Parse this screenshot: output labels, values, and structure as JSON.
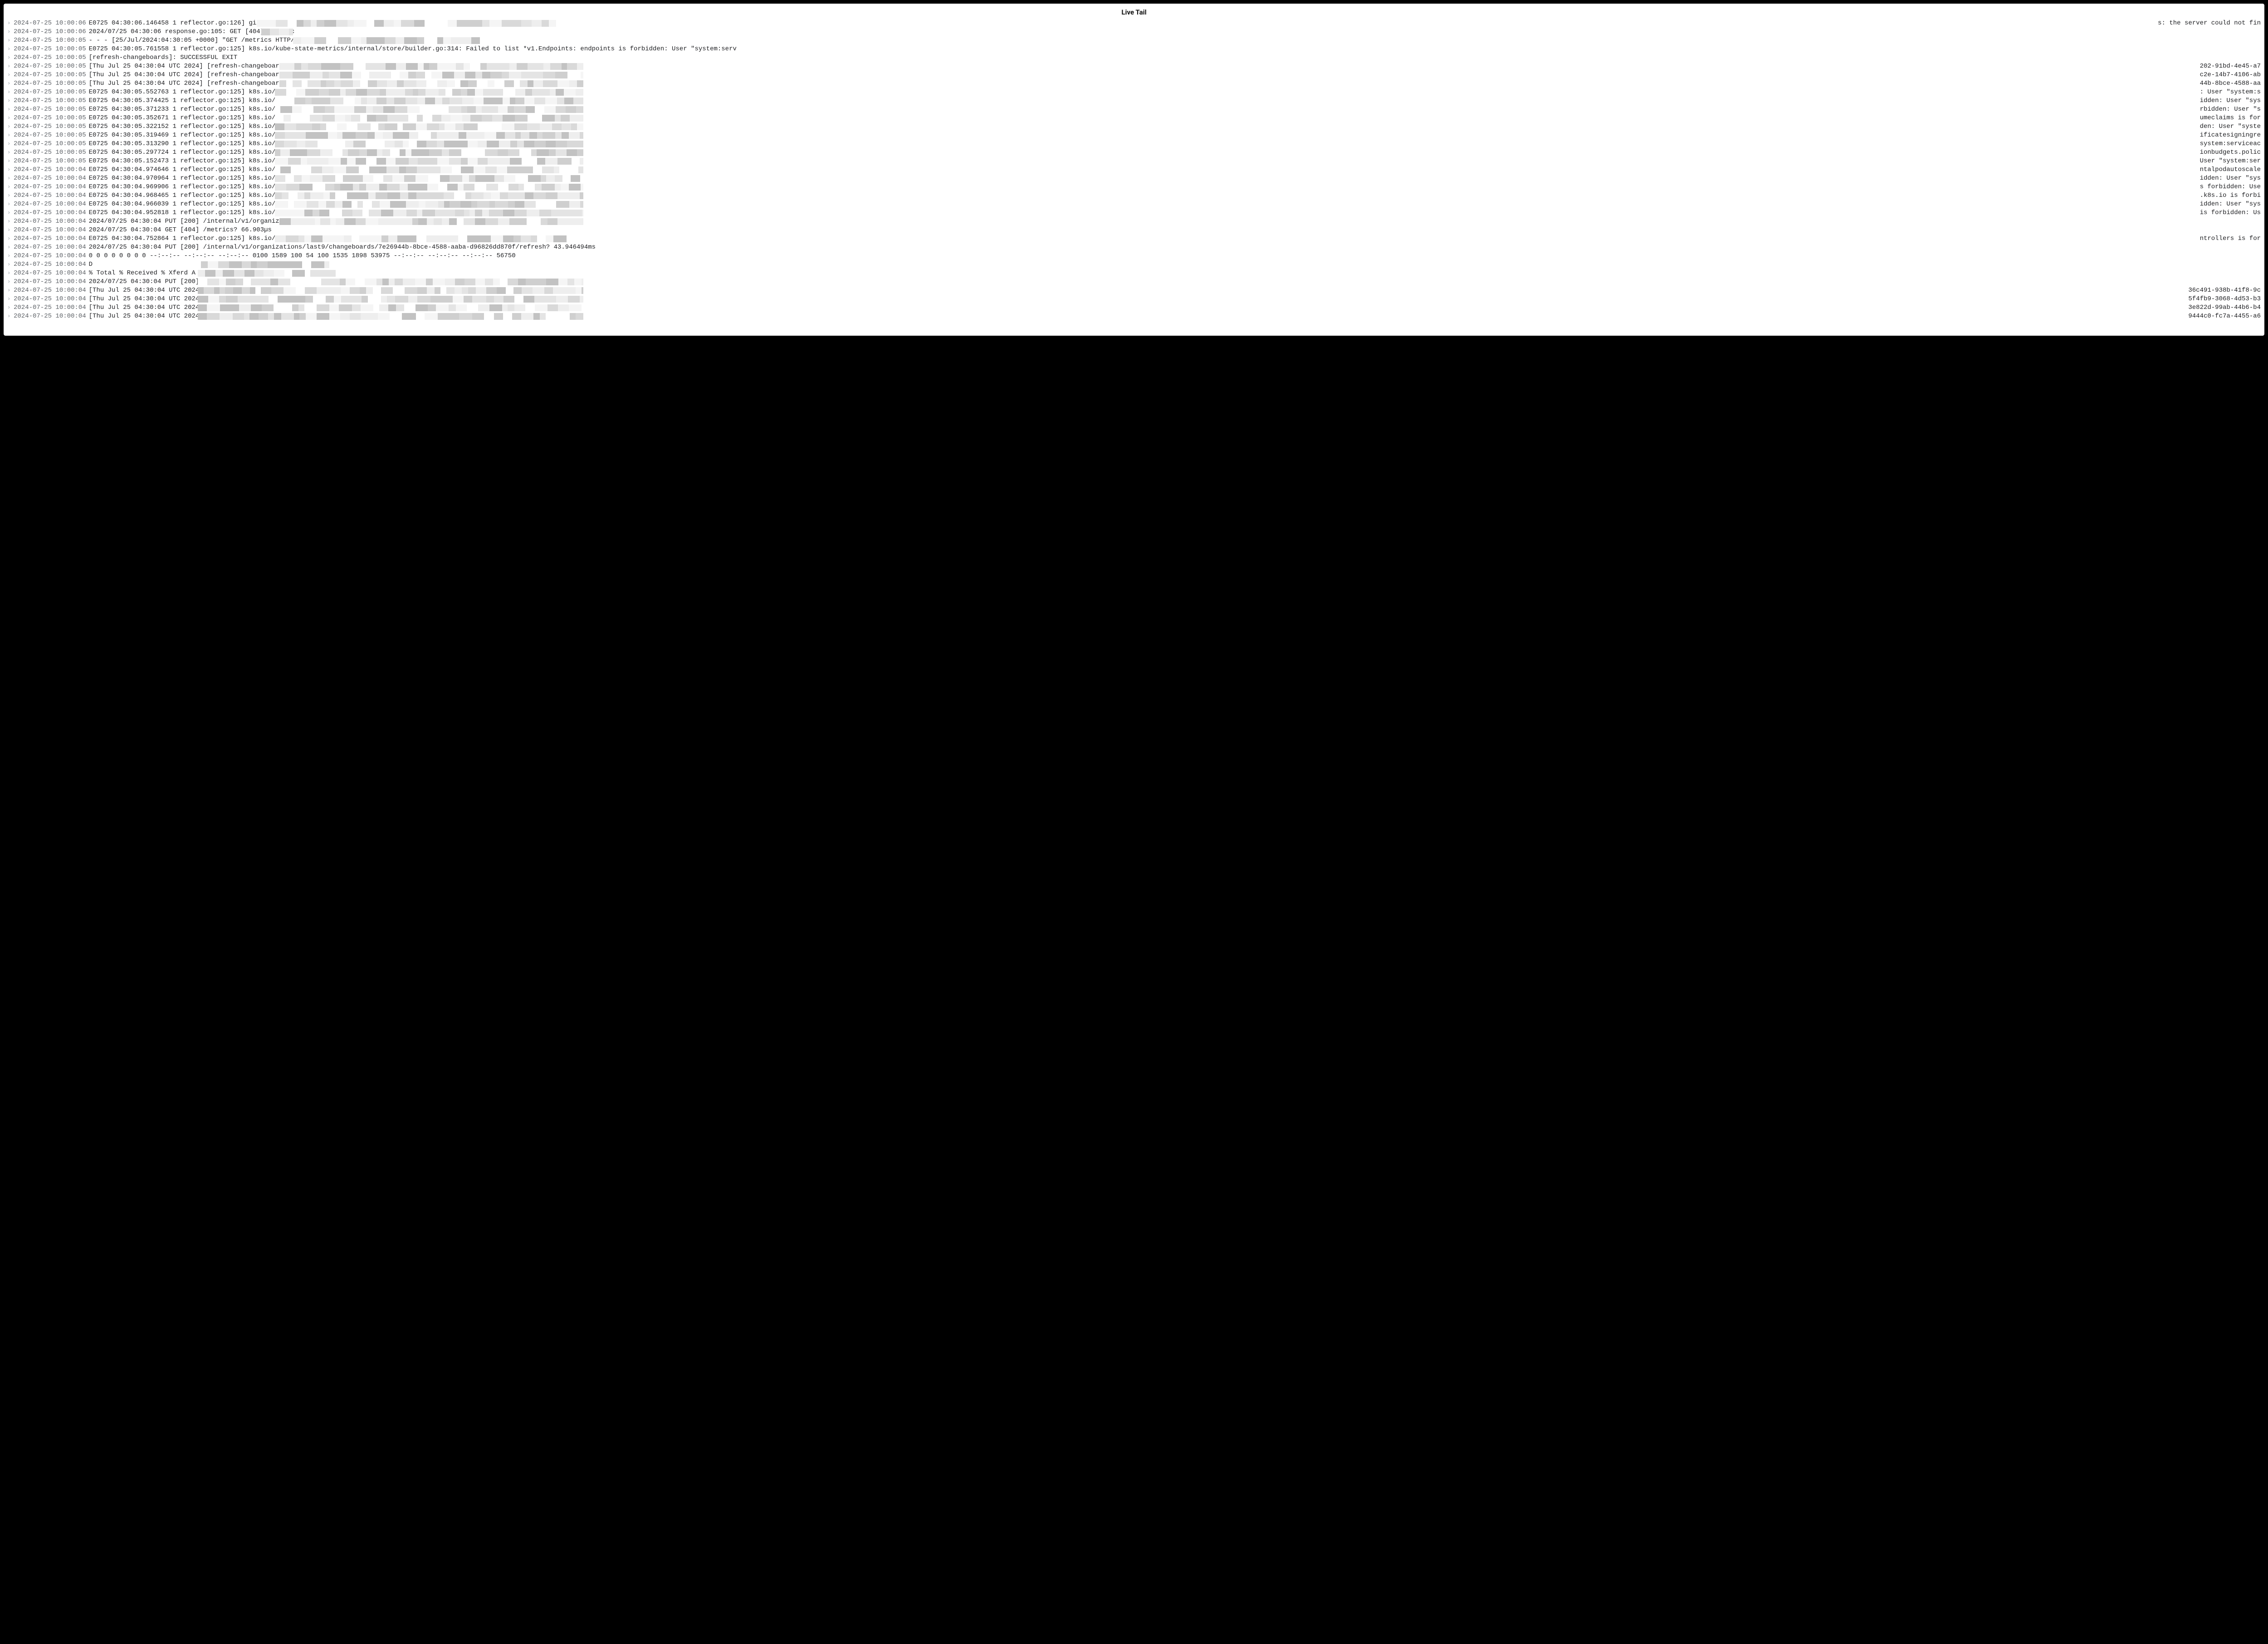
{
  "title": "Live Tail",
  "log_lines": [
    {
      "ts": "2024-07-25 10:00:06",
      "msg": "E0725 04:30:06.146458       1 reflector.go:126] githu",
      "redact_start": 540,
      "redact_end": 1200,
      "tail": "s: the server could not fin"
    },
    {
      "ts": "2024-07-25 10:00:06",
      "msg": "2024/07/25 04:30:06 response.go:105: GET [404] /metric",
      "redact_start": 550,
      "redact_end": 620,
      "tail": ""
    },
    {
      "ts": "2024-07-25 10:00:05",
      "msg": "- - - [25/Jul/2024:04:30:05 +0000] \"GET /metrics HTTP/...",
      "redact_start": 620,
      "redact_end": 1040,
      "tail": ""
    },
    {
      "ts": "2024-07-25 10:00:05",
      "msg": "E0725 04:30:05.761558       1 reflector.go:125] k8s.io/kube-state-metrics/internal/store/builder.go:314: Failed to list *v1.Endpoints: endpoints is forbidden: User \"system:serv",
      "redact_start": 0,
      "redact_end": 0,
      "tail": ""
    },
    {
      "ts": "2024-07-25 10:00:05",
      "msg": "[refresh-changeboards]: SUCCESSFUL EXIT",
      "redact_start": 0,
      "redact_end": 0,
      "tail": ""
    },
    {
      "ts": "2024-07-25 10:00:05",
      "msg": "[Thu Jul 25 04:30:04 UTC 2024] [refresh-changeboards]: TRY",
      "redact_start": 590,
      "redact_end": 1260,
      "tail": "202-91bd-4e45-a7"
    },
    {
      "ts": "2024-07-25 10:00:05",
      "msg": "[Thu Jul 25 04:30:04 UTC 2024] [refresh-changeboards]: TRY",
      "redact_start": 590,
      "redact_end": 1260,
      "tail": "c2e-14b7-4106-ab"
    },
    {
      "ts": "2024-07-25 10:00:05",
      "msg": "[Thu Jul 25 04:30:04 UTC 2024] [refresh-changeboards]: TRY",
      "redact_start": 590,
      "redact_end": 1260,
      "tail": "44b-8bce-4588-aa"
    },
    {
      "ts": "2024-07-25 10:00:05",
      "msg": "E0725 04:30:05.552763       1 reflector.go:125] k8s.io/kub",
      "redact_start": 580,
      "redact_end": 1260,
      "tail": ": User \"system:s"
    },
    {
      "ts": "2024-07-25 10:00:05",
      "msg": "E0725 04:30:05.374425       1 reflector.go:125] k8s.io/kub",
      "redact_start": 580,
      "redact_end": 1260,
      "tail": "idden: User \"sys"
    },
    {
      "ts": "2024-07-25 10:00:05",
      "msg": "E0725 04:30:05.371233       1 reflector.go:125] k8s.io/kub",
      "redact_start": 580,
      "redact_end": 1260,
      "tail": "rbidden: User \"s"
    },
    {
      "ts": "2024-07-25 10:00:05",
      "msg": "E0725 04:30:05.352671       1 reflector.go:125] k8s.io/kub",
      "redact_start": 580,
      "redact_end": 1260,
      "tail": "umeclaims is for"
    },
    {
      "ts": "2024-07-25 10:00:05",
      "msg": "E0725 04:30:05.322152       1 reflector.go:125] k8s.io/kub",
      "redact_start": 580,
      "redact_end": 1260,
      "tail": "den: User \"syste"
    },
    {
      "ts": "2024-07-25 10:00:05",
      "msg": "E0725 04:30:05.319469       1 reflector.go:125] k8s.io/kub",
      "redact_start": 580,
      "redact_end": 1260,
      "tail": "ificatesigningre"
    },
    {
      "ts": "2024-07-25 10:00:05",
      "msg": "E0725 04:30:05.313290       1 reflector.go:125] k8s.io/kub",
      "redact_start": 580,
      "redact_end": 1260,
      "tail": "system:serviceac"
    },
    {
      "ts": "2024-07-25 10:00:05",
      "msg": "E0725 04:30:05.297724       1 reflector.go:125] k8s.io/kub",
      "redact_start": 580,
      "redact_end": 1260,
      "tail": "ionbudgets.polic"
    },
    {
      "ts": "2024-07-25 10:00:05",
      "msg": "E0725 04:30:05.152473       1 reflector.go:125] k8s.io/kub",
      "redact_start": 580,
      "redact_end": 1260,
      "tail": "User \"system:ser"
    },
    {
      "ts": "2024-07-25 10:00:04",
      "msg": "E0725 04:30:04.974646       1 reflector.go:125] k8s.io/kub",
      "redact_start": 580,
      "redact_end": 1260,
      "tail": "ntalpodautoscale"
    },
    {
      "ts": "2024-07-25 10:00:04",
      "msg": "E0725 04:30:04.970964       1 reflector.go:125] k8s.io/kub",
      "redact_start": 580,
      "redact_end": 1260,
      "tail": "idden: User \"sys"
    },
    {
      "ts": "2024-07-25 10:00:04",
      "msg": "E0725 04:30:04.969906       1 reflector.go:125] k8s.io/kub",
      "redact_start": 580,
      "redact_end": 1260,
      "tail": "s forbidden: Use"
    },
    {
      "ts": "2024-07-25 10:00:04",
      "msg": "E0725 04:30:04.968465       1 reflector.go:125] k8s.io/kub",
      "redact_start": 580,
      "redact_end": 1260,
      "tail": ".k8s.io is forbi"
    },
    {
      "ts": "2024-07-25 10:00:04",
      "msg": "E0725 04:30:04.966039       1 reflector.go:125] k8s.io/kub",
      "redact_start": 580,
      "redact_end": 1260,
      "tail": "idden: User \"sys"
    },
    {
      "ts": "2024-07-25 10:00:04",
      "msg": "E0725 04:30:04.952818       1 reflector.go:125] k8s.io/kub",
      "redact_start": 580,
      "redact_end": 1260,
      "tail": "is forbidden: Us"
    },
    {
      "ts": "2024-07-25 10:00:04",
      "msg": "2024/07/25 04:30:04 PUT [200] /internal/v1/organizations/l",
      "redact_start": 590,
      "redact_end": 1260,
      "tail": ""
    },
    {
      "ts": "2024-07-25 10:00:04",
      "msg": "2024/07/25 04:30:04 GET [404] /metrics? 66.903µs",
      "redact_start": 0,
      "redact_end": 0,
      "tail": ""
    },
    {
      "ts": "2024-07-25 10:00:04",
      "msg": "E0725 04:30:04.752864       1 reflector.go:125] k8s.io/kub",
      "redact_start": 580,
      "redact_end": 1260,
      "tail": "ntrollers is for"
    },
    {
      "ts": "2024-07-25 10:00:04",
      "msg": "2024/07/25 04:30:04 PUT [200] /internal/v1/organizations/last9/changeboards/7e26944b-8bce-4588-aaba-d96826dd870f/refresh? 43.946494ms",
      "redact_start": 0,
      "redact_end": 0,
      "tail": ""
    },
    {
      "ts": "2024-07-25 10:00:04",
      "msg": "   0     0    0     0    0     0      0      0 --:--:-- --:--:-- --:--:--     0100  1589  100    54  100  1535   1898  53975 --:--:-- --:--:-- --:--:-- 56750",
      "redact_start": 0,
      "redact_end": 0,
      "tail": ""
    },
    {
      "ts": "2024-07-25 10:00:04",
      "msg": "                                 D",
      "redact_start": 400,
      "redact_end": 700,
      "tail": ""
    },
    {
      "ts": "2024-07-25 10:00:04",
      "msg": "  % Total    % Received % Xferd  A",
      "redact_start": 410,
      "redact_end": 720,
      "tail": ""
    },
    {
      "ts": "2024-07-25 10:00:04",
      "msg": "2024/07/25 04:30:04 PUT [200] /int",
      "redact_start": 410,
      "redact_end": 1260,
      "tail": ""
    },
    {
      "ts": "2024-07-25 10:00:04",
      "msg": "[Thu Jul 25 04:30:04 UTC 2024] [re",
      "redact_start": 410,
      "redact_end": 1260,
      "tail": "36c491-938b-41f8-9c"
    },
    {
      "ts": "2024-07-25 10:00:04",
      "msg": "[Thu Jul 25 04:30:04 UTC 2024] [re",
      "redact_start": 410,
      "redact_end": 1260,
      "tail": "5f4fb9-3068-4d53-b3"
    },
    {
      "ts": "2024-07-25 10:00:04",
      "msg": "[Thu Jul 25 04:30:04 UTC 2024] [re",
      "redact_start": 410,
      "redact_end": 1260,
      "tail": "3e822d-99ab-44b6-b4"
    },
    {
      "ts": "2024-07-25 10:00:04",
      "msg": "[Thu Jul 25 04:30:04 UTC 2024] [re",
      "redact_start": 410,
      "redact_end": 1260,
      "tail": "9444c0-fc7a-4455-a6"
    }
  ]
}
